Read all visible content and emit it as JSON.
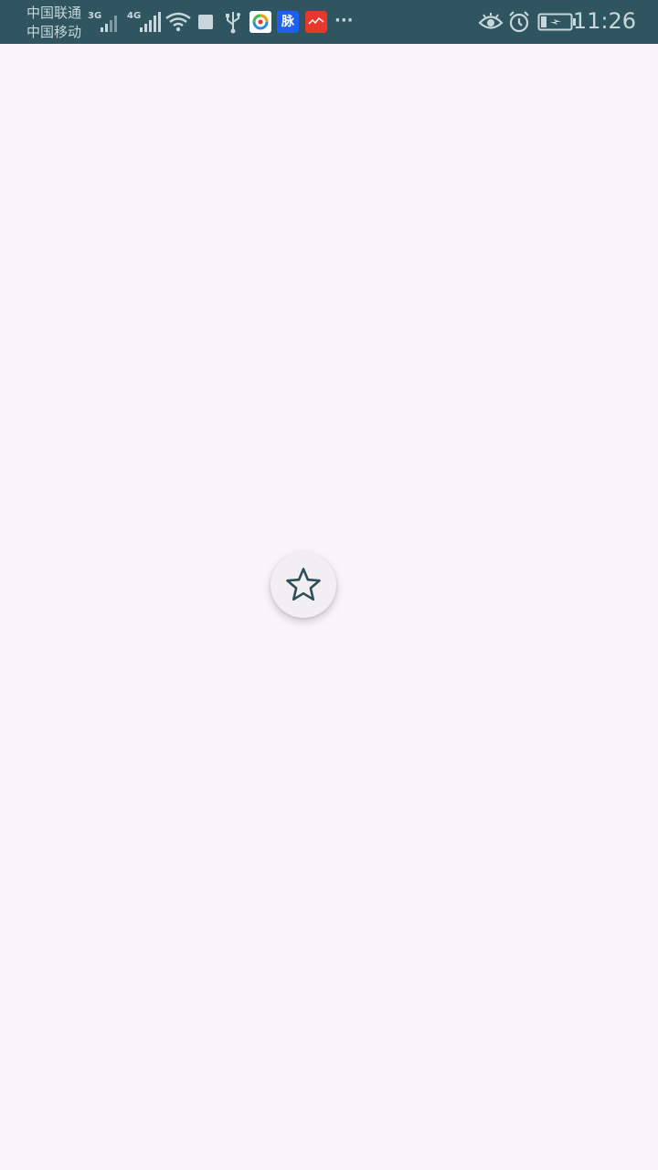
{
  "status_bar": {
    "carrier_1": "中国联通",
    "carrier_2": "中国移动",
    "network_1": "3G",
    "network_2": "4G",
    "app_badge_mai": "脉",
    "more": "···",
    "time": "11:26",
    "background_color": "#2e5560",
    "icons": [
      "signal-3g-icon",
      "signal-4g-icon",
      "wifi-icon",
      "square-notification-icon",
      "usb-icon",
      "tencent-app-icon",
      "maimai-app-icon",
      "red-app-icon",
      "more-notifications-icon",
      "eye-comfort-icon",
      "alarm-icon",
      "battery-charging-icon"
    ]
  },
  "main": {
    "background_color": "#f8f6f9",
    "fab_icon": "star-outline-icon"
  }
}
